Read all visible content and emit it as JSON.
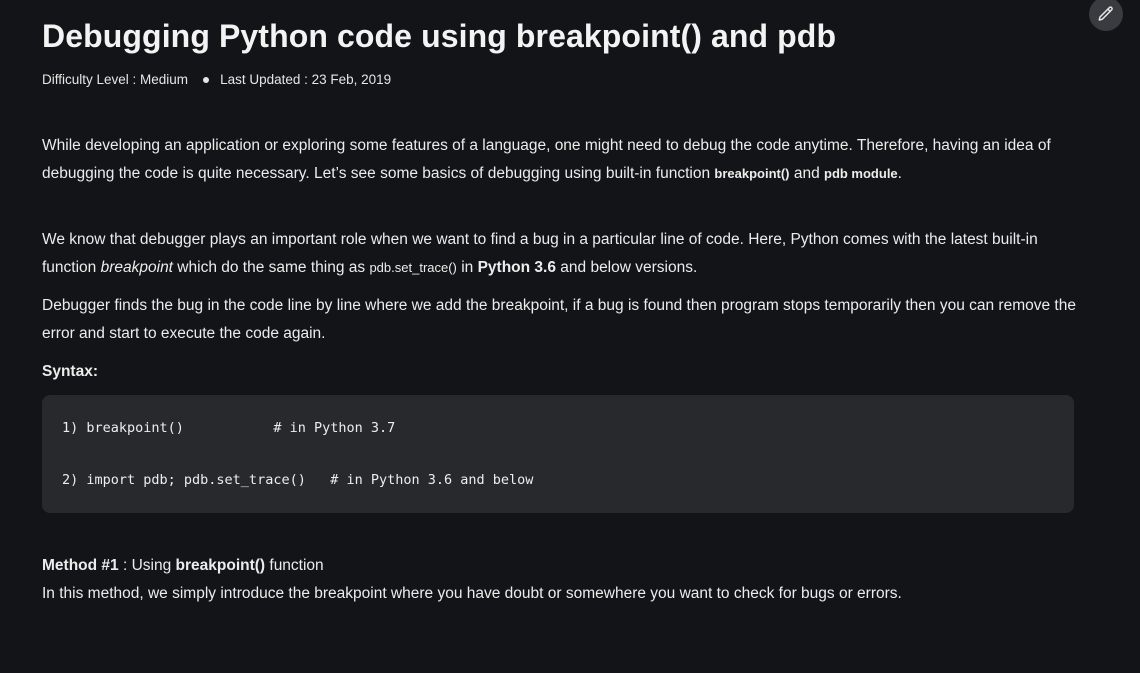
{
  "article": {
    "title": "Debugging Python code using breakpoint() and pdb",
    "difficulty": "Difficulty Level : Medium",
    "last_updated": "Last Updated : 23 Feb, 2019"
  },
  "p1": {
    "text": "While developing an application or exploring some features of a language, one might need to debug the code anytime. Therefore, having an idea of debugging the code is quite necessary. Let’s see some basics of debugging using built-in function ",
    "code1": "breakpoint()",
    "mid": " and ",
    "code2": "pdb module",
    "end": "."
  },
  "p2": {
    "text": "We know that debugger plays an important role when we want to find a bug in a particular line of code. Here, Python comes with the latest built-in function ",
    "italic": "breakpoint",
    "mid": " which do the same thing as ",
    "code": "pdb.set_trace()",
    "mid2": " in ",
    "bold": "Python 3.6",
    "end": " and below versions."
  },
  "p3": {
    "text": "Debugger finds the bug in the code line by line where we add the breakpoint, if a bug is found then program stops temporarily then you can remove the error and start to execute the code again."
  },
  "syntax_heading": "Syntax:",
  "code": {
    "line1": "1) breakpoint()           # in Python 3.7",
    "line2": "2) import pdb; pdb.set_trace()   # in Python 3.6 and below"
  },
  "method": {
    "label": "Method #1",
    "sep": " : Using ",
    "bold": "breakpoint()",
    "after": " function",
    "desc": "In this method, we simply introduce the breakpoint where you have doubt or somewhere you want to check for bugs or errors."
  },
  "icons": {
    "edit": "pencil-icon"
  }
}
